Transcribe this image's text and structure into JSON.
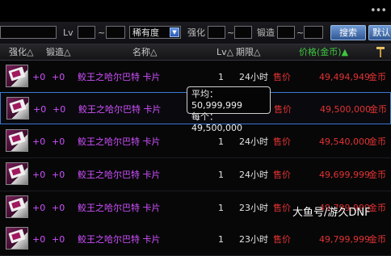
{
  "filter": {
    "level_label": "Lv",
    "range_sep_1": "~",
    "sort_select": "稀有度",
    "enhance_label": "强化",
    "range_sep_2": "~",
    "forge_label": "锻造",
    "range_sep_3": "~",
    "search_button": "搜索",
    "default_button": "默认"
  },
  "header": {
    "enhance": "强化△",
    "forge": "锻造△",
    "name": "名称△",
    "lv": "Lv△",
    "period": "期限△",
    "price": "价格(金币)▲"
  },
  "rows": [
    {
      "enhance": "+0",
      "forge": "+0",
      "name": "鲛王之哈尔巴特  卡片",
      "lv": "1",
      "period": "24小时",
      "price_label": "售价",
      "price": "49,494,949",
      "currency": "金币"
    },
    {
      "enhance": "+0",
      "forge": "+0",
      "name": "鲛王之哈尔巴特  卡片",
      "lv": "1",
      "period": "24小时",
      "price_label": "售价",
      "price": "49,500,000",
      "currency": "金币"
    },
    {
      "enhance": "+0",
      "forge": "+0",
      "name": "鲛王之哈尔巴特  卡片",
      "lv": "1",
      "period": "24小时",
      "price_label": "售价",
      "price": "49,540,000",
      "currency": "金币"
    },
    {
      "enhance": "+0",
      "forge": "+0",
      "name": "鲛王之哈尔巴特  卡片",
      "lv": "1",
      "period": "24小时",
      "price_label": "售价",
      "price": "49,699,999",
      "currency": "金币"
    },
    {
      "enhance": "+0",
      "forge": "+0",
      "name": "鲛王之哈尔巴特  卡片",
      "lv": "1",
      "period": "23小时",
      "price_label": "售价",
      "price": "49,799,999",
      "currency": "金币"
    },
    {
      "enhance": "+0",
      "forge": "+0",
      "name": "鲛王之哈尔巴特  卡片",
      "lv": "1",
      "period": "23小时",
      "price_label": "售价",
      "price": "49,799,999",
      "currency": "金币"
    }
  ],
  "tooltip": {
    "avg": "平均：50,999,999",
    "each": "每个：49,500,000"
  },
  "watermark": "大鱼号/游久DNF",
  "colors": {
    "accent": "#3d79d6",
    "name": "#d050ff",
    "price": "#e23232",
    "sorted_header": "#3ec63e"
  }
}
